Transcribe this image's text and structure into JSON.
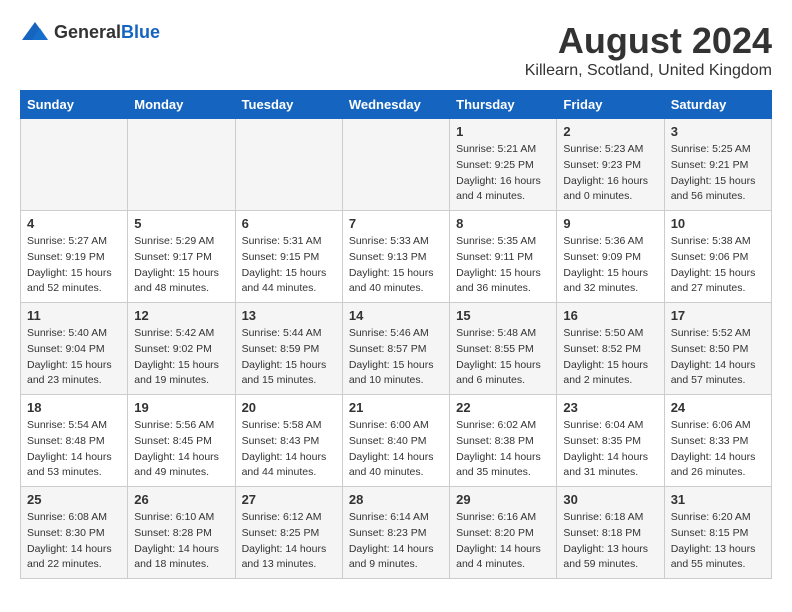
{
  "logo": {
    "text_general": "General",
    "text_blue": "Blue"
  },
  "title": "August 2024",
  "subtitle": "Killearn, Scotland, United Kingdom",
  "days_of_week": [
    "Sunday",
    "Monday",
    "Tuesday",
    "Wednesday",
    "Thursday",
    "Friday",
    "Saturday"
  ],
  "weeks": [
    [
      {
        "day": "",
        "info": ""
      },
      {
        "day": "",
        "info": ""
      },
      {
        "day": "",
        "info": ""
      },
      {
        "day": "",
        "info": ""
      },
      {
        "day": "1",
        "info": "Sunrise: 5:21 AM\nSunset: 9:25 PM\nDaylight: 16 hours\nand 4 minutes."
      },
      {
        "day": "2",
        "info": "Sunrise: 5:23 AM\nSunset: 9:23 PM\nDaylight: 16 hours\nand 0 minutes."
      },
      {
        "day": "3",
        "info": "Sunrise: 5:25 AM\nSunset: 9:21 PM\nDaylight: 15 hours\nand 56 minutes."
      }
    ],
    [
      {
        "day": "4",
        "info": "Sunrise: 5:27 AM\nSunset: 9:19 PM\nDaylight: 15 hours\nand 52 minutes."
      },
      {
        "day": "5",
        "info": "Sunrise: 5:29 AM\nSunset: 9:17 PM\nDaylight: 15 hours\nand 48 minutes."
      },
      {
        "day": "6",
        "info": "Sunrise: 5:31 AM\nSunset: 9:15 PM\nDaylight: 15 hours\nand 44 minutes."
      },
      {
        "day": "7",
        "info": "Sunrise: 5:33 AM\nSunset: 9:13 PM\nDaylight: 15 hours\nand 40 minutes."
      },
      {
        "day": "8",
        "info": "Sunrise: 5:35 AM\nSunset: 9:11 PM\nDaylight: 15 hours\nand 36 minutes."
      },
      {
        "day": "9",
        "info": "Sunrise: 5:36 AM\nSunset: 9:09 PM\nDaylight: 15 hours\nand 32 minutes."
      },
      {
        "day": "10",
        "info": "Sunrise: 5:38 AM\nSunset: 9:06 PM\nDaylight: 15 hours\nand 27 minutes."
      }
    ],
    [
      {
        "day": "11",
        "info": "Sunrise: 5:40 AM\nSunset: 9:04 PM\nDaylight: 15 hours\nand 23 minutes."
      },
      {
        "day": "12",
        "info": "Sunrise: 5:42 AM\nSunset: 9:02 PM\nDaylight: 15 hours\nand 19 minutes."
      },
      {
        "day": "13",
        "info": "Sunrise: 5:44 AM\nSunset: 8:59 PM\nDaylight: 15 hours\nand 15 minutes."
      },
      {
        "day": "14",
        "info": "Sunrise: 5:46 AM\nSunset: 8:57 PM\nDaylight: 15 hours\nand 10 minutes."
      },
      {
        "day": "15",
        "info": "Sunrise: 5:48 AM\nSunset: 8:55 PM\nDaylight: 15 hours\nand 6 minutes."
      },
      {
        "day": "16",
        "info": "Sunrise: 5:50 AM\nSunset: 8:52 PM\nDaylight: 15 hours\nand 2 minutes."
      },
      {
        "day": "17",
        "info": "Sunrise: 5:52 AM\nSunset: 8:50 PM\nDaylight: 14 hours\nand 57 minutes."
      }
    ],
    [
      {
        "day": "18",
        "info": "Sunrise: 5:54 AM\nSunset: 8:48 PM\nDaylight: 14 hours\nand 53 minutes."
      },
      {
        "day": "19",
        "info": "Sunrise: 5:56 AM\nSunset: 8:45 PM\nDaylight: 14 hours\nand 49 minutes."
      },
      {
        "day": "20",
        "info": "Sunrise: 5:58 AM\nSunset: 8:43 PM\nDaylight: 14 hours\nand 44 minutes."
      },
      {
        "day": "21",
        "info": "Sunrise: 6:00 AM\nSunset: 8:40 PM\nDaylight: 14 hours\nand 40 minutes."
      },
      {
        "day": "22",
        "info": "Sunrise: 6:02 AM\nSunset: 8:38 PM\nDaylight: 14 hours\nand 35 minutes."
      },
      {
        "day": "23",
        "info": "Sunrise: 6:04 AM\nSunset: 8:35 PM\nDaylight: 14 hours\nand 31 minutes."
      },
      {
        "day": "24",
        "info": "Sunrise: 6:06 AM\nSunset: 8:33 PM\nDaylight: 14 hours\nand 26 minutes."
      }
    ],
    [
      {
        "day": "25",
        "info": "Sunrise: 6:08 AM\nSunset: 8:30 PM\nDaylight: 14 hours\nand 22 minutes."
      },
      {
        "day": "26",
        "info": "Sunrise: 6:10 AM\nSunset: 8:28 PM\nDaylight: 14 hours\nand 18 minutes."
      },
      {
        "day": "27",
        "info": "Sunrise: 6:12 AM\nSunset: 8:25 PM\nDaylight: 14 hours\nand 13 minutes."
      },
      {
        "day": "28",
        "info": "Sunrise: 6:14 AM\nSunset: 8:23 PM\nDaylight: 14 hours\nand 9 minutes."
      },
      {
        "day": "29",
        "info": "Sunrise: 6:16 AM\nSunset: 8:20 PM\nDaylight: 14 hours\nand 4 minutes."
      },
      {
        "day": "30",
        "info": "Sunrise: 6:18 AM\nSunset: 8:18 PM\nDaylight: 13 hours\nand 59 minutes."
      },
      {
        "day": "31",
        "info": "Sunrise: 6:20 AM\nSunset: 8:15 PM\nDaylight: 13 hours\nand 55 minutes."
      }
    ]
  ]
}
